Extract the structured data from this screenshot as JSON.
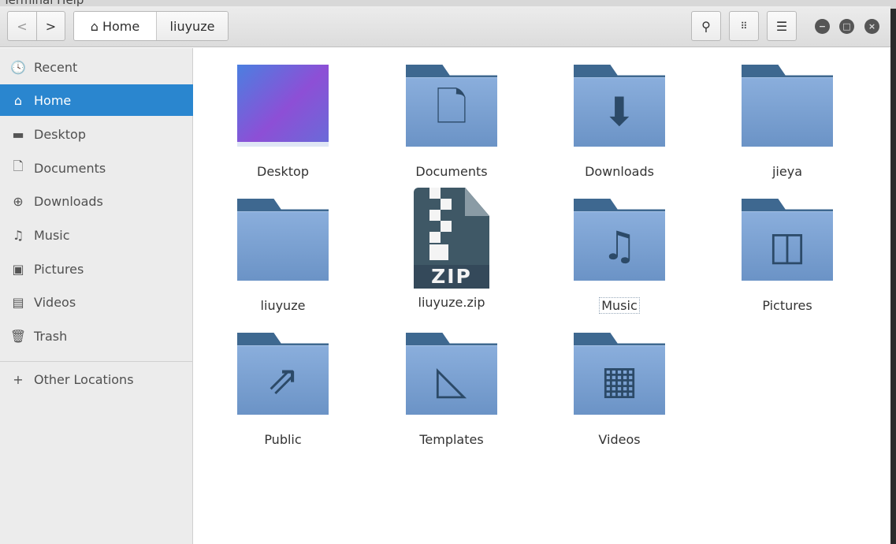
{
  "behind_window_text": "Terminal   Help",
  "header": {
    "back": "<",
    "forward": ">",
    "breadcrumbs": [
      {
        "label": "Home",
        "icon": "home-icon"
      },
      {
        "label": "liuyuze"
      }
    ],
    "search": "search-icon",
    "view": "grid-view-icon",
    "menu": "hamburger-menu-icon",
    "minimize": "minimize-icon",
    "maximize": "maximize-icon",
    "close": "close-icon"
  },
  "sidebar": {
    "items": [
      {
        "label": "Recent",
        "icon": "🕓"
      },
      {
        "label": "Home",
        "icon": "⌂"
      },
      {
        "label": "Desktop",
        "icon": "▬"
      },
      {
        "label": "Documents",
        "icon": "🗋"
      },
      {
        "label": "Downloads",
        "icon": "⊕"
      },
      {
        "label": "Music",
        "icon": "♫"
      },
      {
        "label": "Pictures",
        "icon": "▣"
      },
      {
        "label": "Videos",
        "icon": "▤"
      },
      {
        "label": "Trash",
        "icon": "🗑"
      },
      {
        "label": "Other Locations",
        "icon": "+"
      }
    ]
  },
  "files": [
    {
      "name": "Desktop"
    },
    {
      "name": "Documents",
      "symbol": "🗋"
    },
    {
      "name": "Downloads",
      "symbol": "⬇"
    },
    {
      "name": "jieya",
      "symbol": ""
    },
    {
      "name": "liuyuze",
      "symbol": ""
    },
    {
      "name": "liuyuze.zip",
      "badge": "ZIP"
    },
    {
      "name": "Music",
      "symbol": "♫"
    },
    {
      "name": "Pictures",
      "symbol": "◫"
    },
    {
      "name": "Public",
      "symbol": "⇗"
    },
    {
      "name": "Templates",
      "symbol": "◺"
    },
    {
      "name": "Videos",
      "symbol": "▦"
    }
  ]
}
